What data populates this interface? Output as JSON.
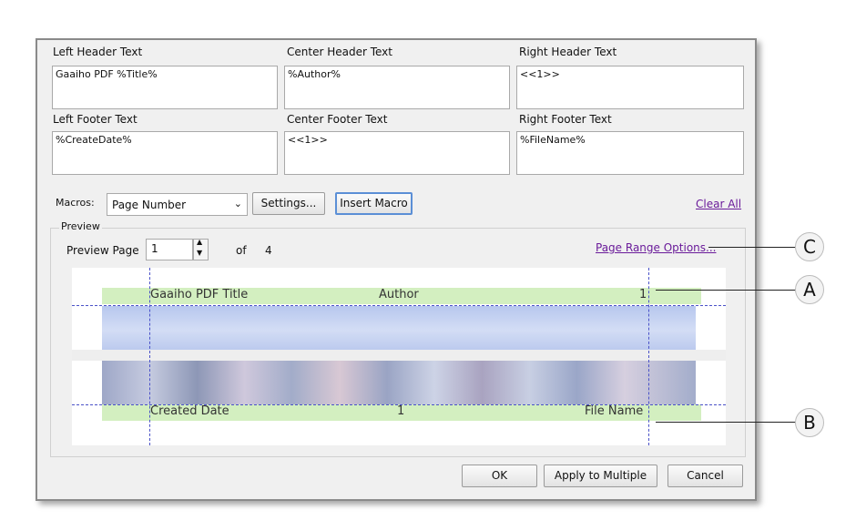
{
  "header": {
    "left_label": "Left Header Text",
    "left_value": "Gaaiho PDF %Title%",
    "center_label": "Center Header Text",
    "center_value": "%Author%",
    "right_label": "Right Header Text",
    "right_value": "<<1>>"
  },
  "footer": {
    "left_label": "Left Footer Text",
    "left_value": "%CreateDate%",
    "center_label": "Center Footer Text",
    "center_value": "<<1>>",
    "right_label": "Right Footer Text",
    "right_value": "%FileName%"
  },
  "macros": {
    "label": "Macros:",
    "selected": "Page Number",
    "settings_button": "Settings...",
    "insert_button": "Insert Macro",
    "clear_all": "Clear All"
  },
  "preview": {
    "group_label": "Preview",
    "page_label": "Preview Page",
    "page_value": "1",
    "of_label": "of",
    "total_pages": "4",
    "range_options": "Page Range Options...",
    "header_left": "Gaaiho PDF Title",
    "header_center": "Author",
    "header_right": "1",
    "footer_left": "Created Date",
    "footer_center": "1",
    "footer_right": "File Name"
  },
  "buttons": {
    "ok": "OK",
    "apply_multiple": "Apply to Multiple",
    "cancel": "Cancel"
  },
  "callouts": {
    "a": "A",
    "b": "B",
    "c": "C"
  },
  "colors": {
    "band_green": "#d3efc0",
    "guide_blue": "#4a52c8",
    "link_purple": "#6a1b9a"
  }
}
